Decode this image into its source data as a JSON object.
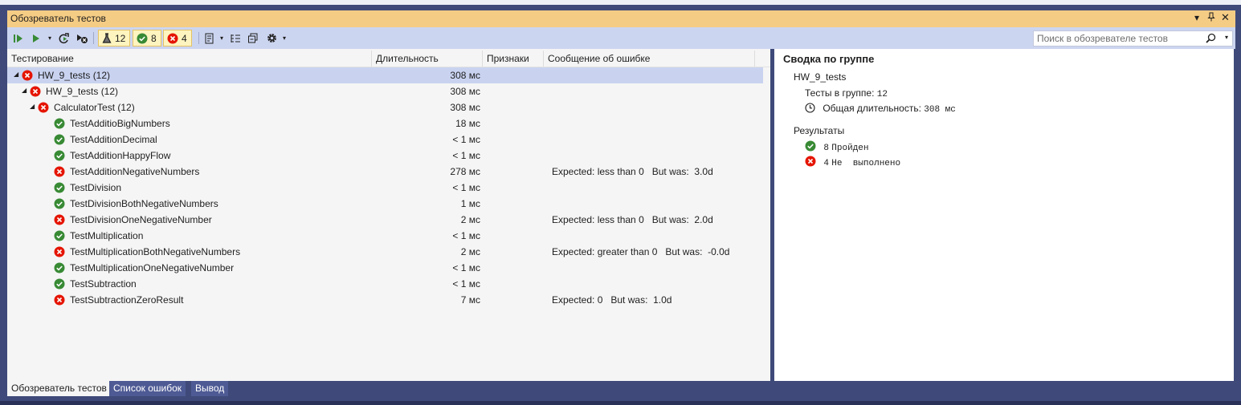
{
  "window": {
    "title": "Обозреватель тестов",
    "pin_glyph": "▾ ꟼ ✕"
  },
  "toolbar": {
    "counts": {
      "total": "12",
      "passed": "8",
      "failed": "4"
    },
    "search_placeholder": "Поиск в обозревателе тестов"
  },
  "columns": {
    "test": "Тестирование",
    "duration": "Длительность",
    "traits": "Признаки",
    "error": "Сообщение об ошибке"
  },
  "tree": [
    {
      "level": 0,
      "status": "failed",
      "expander": "◢",
      "name": "HW_9_tests  (12)",
      "duration": "308 мс",
      "error": "",
      "selected": true
    },
    {
      "level": 1,
      "status": "failed",
      "expander": "◢",
      "name": "HW_9_tests  (12)",
      "duration": "308 мс",
      "error": ""
    },
    {
      "level": 2,
      "status": "failed",
      "expander": "◢",
      "name": "CalculatorTest  (12)",
      "duration": "308 мс",
      "error": ""
    },
    {
      "level": 3,
      "status": "passed",
      "name": "TestAdditioBigNumbers",
      "duration": "18 мс",
      "error": ""
    },
    {
      "level": 3,
      "status": "passed",
      "name": "TestAdditionDecimal",
      "duration": "< 1 мс",
      "error": ""
    },
    {
      "level": 3,
      "status": "passed",
      "name": "TestAdditionHappyFlow",
      "duration": "< 1 мс",
      "error": ""
    },
    {
      "level": 3,
      "status": "failed",
      "name": "TestAdditionNegativeNumbers",
      "duration": "278 мс",
      "error": "Expected: less than 0   But was:  3.0d"
    },
    {
      "level": 3,
      "status": "passed",
      "name": "TestDivision",
      "duration": "< 1 мс",
      "error": ""
    },
    {
      "level": 3,
      "status": "passed",
      "name": "TestDivisionBothNegativeNumbers",
      "duration": "1 мс",
      "error": ""
    },
    {
      "level": 3,
      "status": "failed",
      "name": "TestDivisionOneNegativeNumber",
      "duration": "2 мс",
      "error": "Expected: less than 0   But was:  2.0d"
    },
    {
      "level": 3,
      "status": "passed",
      "name": "TestMultiplication",
      "duration": "< 1 мс",
      "error": ""
    },
    {
      "level": 3,
      "status": "failed",
      "name": "TestMultiplicationBothNegativeNumbers",
      "duration": "2 мс",
      "error": "Expected: greater than 0   But was:  -0.0d"
    },
    {
      "level": 3,
      "status": "passed",
      "name": "TestMultiplicationOneNegativeNumber",
      "duration": "< 1 мс",
      "error": ""
    },
    {
      "level": 3,
      "status": "passed",
      "name": "TestSubtraction",
      "duration": "< 1 мс",
      "error": ""
    },
    {
      "level": 3,
      "status": "failed",
      "name": "TestSubtractionZeroResult",
      "duration": "7 мс",
      "error": "Expected: 0   But was:  1.0d"
    }
  ],
  "summary": {
    "title": "Сводка по группе",
    "group_name": "HW_9_tests",
    "tests_in_group_label": "Тесты в группе:",
    "tests_in_group_value": "12",
    "total_duration_label": "Общая длительность:",
    "total_duration_value": "308 мс",
    "results_label": "Результаты",
    "passed_count": "8",
    "passed_label": "Пройден",
    "failed_count": "4",
    "failed_label": "Не  выполнено"
  },
  "bottom_tabs": [
    "Обозреватель тестов",
    "Список ошибок",
    "Вывод"
  ],
  "colors": {
    "passed": "#388a34",
    "failed": "#e51400",
    "accent_titlebar": "#f5cc84",
    "toolbar": "#ccd5f0",
    "frame": "#3f4a7a"
  }
}
